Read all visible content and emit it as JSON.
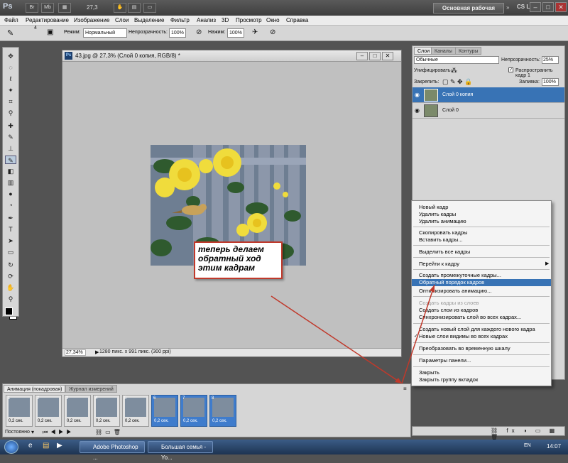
{
  "app": {
    "logo": "Ps",
    "zoom": "27,3",
    "workspace": "Основная рабочая среда",
    "cs_live": "CS Live"
  },
  "menu": [
    "Файл",
    "Редактирование",
    "Изображение",
    "Слои",
    "Выделение",
    "Фильтр",
    "Анализ",
    "3D",
    "Просмотр",
    "Окно",
    "Справка"
  ],
  "options": {
    "brush_size": "4",
    "mode_label": "Режим:",
    "mode_value": "Нормальный",
    "opacity_label": "Непрозрачность:",
    "opacity_value": "100%",
    "pressure_label": "Нажим:",
    "pressure_value": "100%"
  },
  "document": {
    "title": "43.jpg @ 27,3% (Слой 0 копия, RGB/8) *",
    "zoom": "27,34%",
    "info": "1280 пикс. x 991 пикс. (300 ppi)"
  },
  "annotation": "теперь делаем обратный ход этим кадрам",
  "layers_panel": {
    "tabs": [
      "Слои",
      "Каналы",
      "Контуры"
    ],
    "blend_mode": "Обычные",
    "opacity_label": "Непрозрачность:",
    "opacity_value": "25%",
    "unify_label": "Унифицировать:",
    "propagate_label": "Распространить кадр 1",
    "lock_label": "Закрепить:",
    "fill_label": "Заливка:",
    "fill_value": "100%",
    "layers": [
      "Слой 0 копия",
      "Слой 0"
    ]
  },
  "context_menu": {
    "items": [
      "Новый кадр",
      "Удалить кадры",
      "Удалить анимацию",
      "Скопировать кадры",
      "Вставить кадры...",
      "Выделить все кадры",
      "Перейти к кадру",
      "Создать промежуточные кадры...",
      "Обратный порядок кадров",
      "Оптимизировать анимацию...",
      "Создать кадры из слоев",
      "Создать слои из кадров",
      "Синхронизировать слой во всех кадрах...",
      "Создать новый слой для каждого нового кадра",
      "Новые слои видимы во всех кадрах",
      "Преобразовать во временную шкалу",
      "Параметры панели...",
      "Закрыть",
      "Закрыть группу вкладок"
    ]
  },
  "animation_panel": {
    "tabs": [
      "Анимация (покадровая)",
      "Журнал измерений"
    ],
    "frames": [
      {
        "num": "1",
        "delay": "0,2 сек."
      },
      {
        "num": "2",
        "delay": "0,2 сек."
      },
      {
        "num": "3",
        "delay": "0,2 сек."
      },
      {
        "num": "4",
        "delay": "0,2 сек."
      },
      {
        "num": "5",
        "delay": "0,2 сек."
      },
      {
        "num": "6",
        "delay": "0,2 сек."
      },
      {
        "num": "7",
        "delay": "0,2 сек."
      },
      {
        "num": "8",
        "delay": "0,2 сек."
      }
    ],
    "loop": "Постоянно"
  },
  "taskbar": {
    "task1": "Adobe Photoshop ...",
    "task2": "Большая семья - Yo...",
    "lang": "EN",
    "time": "14:07"
  },
  "colors": {
    "highlight": "#3873b5",
    "arrow": "#c0392b"
  }
}
